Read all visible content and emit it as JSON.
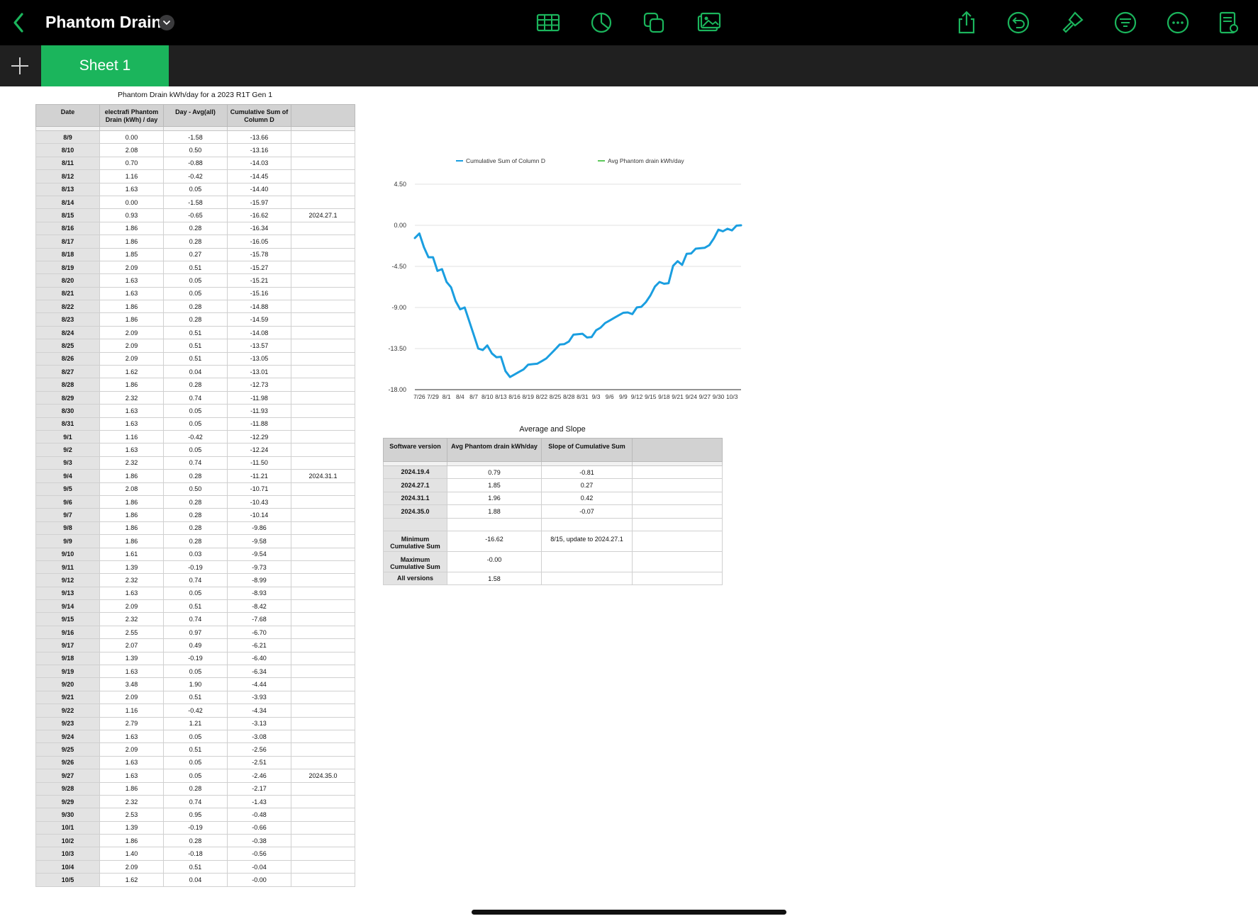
{
  "app": {
    "title": "Phantom Drain",
    "accent": "#1bb55c",
    "toolbar_icons": [
      "table-icon",
      "chart-icon",
      "shapes-icon",
      "media-icon",
      "share-icon",
      "undo-icon",
      "format-brush-icon",
      "organize-icon",
      "more-icon",
      "document-setup-icon"
    ]
  },
  "tabs": [
    {
      "label": "Sheet 1",
      "active": true
    }
  ],
  "data_table": {
    "title": "Phantom Drain kWh/day for a 2023 R1T Gen 1",
    "headers": [
      "Date",
      "electrafi Phantom Drain (kWh) / day",
      "Day - Avg(all)",
      "Cumulative Sum of Column D",
      ""
    ],
    "rows": [
      [
        "8/9",
        "0.00",
        "-1.58",
        "-13.66",
        ""
      ],
      [
        "8/10",
        "2.08",
        "0.50",
        "-13.16",
        ""
      ],
      [
        "8/11",
        "0.70",
        "-0.88",
        "-14.03",
        ""
      ],
      [
        "8/12",
        "1.16",
        "-0.42",
        "-14.45",
        ""
      ],
      [
        "8/13",
        "1.63",
        "0.05",
        "-14.40",
        ""
      ],
      [
        "8/14",
        "0.00",
        "-1.58",
        "-15.97",
        ""
      ],
      [
        "8/15",
        "0.93",
        "-0.65",
        "-16.62",
        "2024.27.1"
      ],
      [
        "8/16",
        "1.86",
        "0.28",
        "-16.34",
        ""
      ],
      [
        "8/17",
        "1.86",
        "0.28",
        "-16.05",
        ""
      ],
      [
        "8/18",
        "1.85",
        "0.27",
        "-15.78",
        ""
      ],
      [
        "8/19",
        "2.09",
        "0.51",
        "-15.27",
        ""
      ],
      [
        "8/20",
        "1.63",
        "0.05",
        "-15.21",
        ""
      ],
      [
        "8/21",
        "1.63",
        "0.05",
        "-15.16",
        ""
      ],
      [
        "8/22",
        "1.86",
        "0.28",
        "-14.88",
        ""
      ],
      [
        "8/23",
        "1.86",
        "0.28",
        "-14.59",
        ""
      ],
      [
        "8/24",
        "2.09",
        "0.51",
        "-14.08",
        ""
      ],
      [
        "8/25",
        "2.09",
        "0.51",
        "-13.57",
        ""
      ],
      [
        "8/26",
        "2.09",
        "0.51",
        "-13.05",
        ""
      ],
      [
        "8/27",
        "1.62",
        "0.04",
        "-13.01",
        ""
      ],
      [
        "8/28",
        "1.86",
        "0.28",
        "-12.73",
        ""
      ],
      [
        "8/29",
        "2.32",
        "0.74",
        "-11.98",
        ""
      ],
      [
        "8/30",
        "1.63",
        "0.05",
        "-11.93",
        ""
      ],
      [
        "8/31",
        "1.63",
        "0.05",
        "-11.88",
        ""
      ],
      [
        "9/1",
        "1.16",
        "-0.42",
        "-12.29",
        ""
      ],
      [
        "9/2",
        "1.63",
        "0.05",
        "-12.24",
        ""
      ],
      [
        "9/3",
        "2.32",
        "0.74",
        "-11.50",
        ""
      ],
      [
        "9/4",
        "1.86",
        "0.28",
        "-11.21",
        "2024.31.1"
      ],
      [
        "9/5",
        "2.08",
        "0.50",
        "-10.71",
        ""
      ],
      [
        "9/6",
        "1.86",
        "0.28",
        "-10.43",
        ""
      ],
      [
        "9/7",
        "1.86",
        "0.28",
        "-10.14",
        ""
      ],
      [
        "9/8",
        "1.86",
        "0.28",
        "-9.86",
        ""
      ],
      [
        "9/9",
        "1.86",
        "0.28",
        "-9.58",
        ""
      ],
      [
        "9/10",
        "1.61",
        "0.03",
        "-9.54",
        ""
      ],
      [
        "9/11",
        "1.39",
        "-0.19",
        "-9.73",
        ""
      ],
      [
        "9/12",
        "2.32",
        "0.74",
        "-8.99",
        ""
      ],
      [
        "9/13",
        "1.63",
        "0.05",
        "-8.93",
        ""
      ],
      [
        "9/14",
        "2.09",
        "0.51",
        "-8.42",
        ""
      ],
      [
        "9/15",
        "2.32",
        "0.74",
        "-7.68",
        ""
      ],
      [
        "9/16",
        "2.55",
        "0.97",
        "-6.70",
        ""
      ],
      [
        "9/17",
        "2.07",
        "0.49",
        "-6.21",
        ""
      ],
      [
        "9/18",
        "1.39",
        "-0.19",
        "-6.40",
        ""
      ],
      [
        "9/19",
        "1.63",
        "0.05",
        "-6.34",
        ""
      ],
      [
        "9/20",
        "3.48",
        "1.90",
        "-4.44",
        ""
      ],
      [
        "9/21",
        "2.09",
        "0.51",
        "-3.93",
        ""
      ],
      [
        "9/22",
        "1.16",
        "-0.42",
        "-4.34",
        ""
      ],
      [
        "9/23",
        "2.79",
        "1.21",
        "-3.13",
        ""
      ],
      [
        "9/24",
        "1.63",
        "0.05",
        "-3.08",
        ""
      ],
      [
        "9/25",
        "2.09",
        "0.51",
        "-2.56",
        ""
      ],
      [
        "9/26",
        "1.63",
        "0.05",
        "-2.51",
        ""
      ],
      [
        "9/27",
        "1.63",
        "0.05",
        "-2.46",
        "2024.35.0"
      ],
      [
        "9/28",
        "1.86",
        "0.28",
        "-2.17",
        ""
      ],
      [
        "9/29",
        "2.32",
        "0.74",
        "-1.43",
        ""
      ],
      [
        "9/30",
        "2.53",
        "0.95",
        "-0.48",
        ""
      ],
      [
        "10/1",
        "1.39",
        "-0.19",
        "-0.66",
        ""
      ],
      [
        "10/2",
        "1.86",
        "0.28",
        "-0.38",
        ""
      ],
      [
        "10/3",
        "1.40",
        "-0.18",
        "-0.56",
        ""
      ],
      [
        "10/4",
        "2.09",
        "0.51",
        "-0.04",
        ""
      ],
      [
        "10/5",
        "1.62",
        "0.04",
        "-0.00",
        ""
      ]
    ]
  },
  "chart_data": {
    "type": "line",
    "title": "",
    "xlabel": "",
    "ylabel": "",
    "legend_position": "top",
    "grid": true,
    "ylim": [
      -18.0,
      4.5
    ],
    "y_ticks": [
      "4.50",
      "0.00",
      "-4.50",
      "-9.00",
      "-13.50",
      "-18.00"
    ],
    "x_ticks": [
      "7/26",
      "7/29",
      "8/1",
      "8/4",
      "8/7",
      "8/10",
      "8/13",
      "8/16",
      "8/19",
      "8/22",
      "8/25",
      "8/28",
      "8/31",
      "9/3",
      "9/6",
      "9/9",
      "9/12",
      "9/15",
      "9/18",
      "9/21",
      "9/24",
      "9/27",
      "9/30",
      "10/3"
    ],
    "x_dates": [
      "7/25",
      "7/26",
      "7/27",
      "7/28",
      "7/29",
      "7/30",
      "7/31",
      "8/1",
      "8/2",
      "8/3",
      "8/4",
      "8/5",
      "8/6",
      "8/7",
      "8/8",
      "8/9",
      "8/10",
      "8/11",
      "8/12",
      "8/13",
      "8/14",
      "8/15",
      "8/16",
      "8/17",
      "8/18",
      "8/19",
      "8/20",
      "8/21",
      "8/22",
      "8/23",
      "8/24",
      "8/25",
      "8/26",
      "8/27",
      "8/28",
      "8/29",
      "8/30",
      "8/31",
      "9/1",
      "9/2",
      "9/3",
      "9/4",
      "9/5",
      "9/6",
      "9/7",
      "9/8",
      "9/9",
      "9/10",
      "9/11",
      "9/12",
      "9/13",
      "9/14",
      "9/15",
      "9/16",
      "9/17",
      "9/18",
      "9/19",
      "9/20",
      "9/21",
      "9/22",
      "9/23",
      "9/24",
      "9/25",
      "9/26",
      "9/27",
      "9/28",
      "9/29",
      "9/30",
      "10/1",
      "10/2",
      "10/3",
      "10/4",
      "10/5"
    ],
    "series": [
      {
        "name": "Cumulative Sum of Column D",
        "color": "#1a9ee0",
        "values": [
          -1.4,
          -0.9,
          -2.4,
          -3.5,
          -3.5,
          -5.0,
          -4.8,
          -6.2,
          -6.8,
          -8.3,
          -9.2,
          -9.0,
          -10.5,
          -12.0,
          -13.5,
          -13.66,
          -13.16,
          -14.03,
          -14.45,
          -14.4,
          -15.97,
          -16.62,
          -16.34,
          -16.05,
          -15.78,
          -15.27,
          -15.21,
          -15.16,
          -14.88,
          -14.59,
          -14.08,
          -13.57,
          -13.05,
          -13.01,
          -12.73,
          -11.98,
          -11.93,
          -11.88,
          -12.29,
          -12.24,
          -11.5,
          -11.21,
          -10.71,
          -10.43,
          -10.14,
          -9.86,
          -9.58,
          -9.54,
          -9.73,
          -8.99,
          -8.93,
          -8.42,
          -7.68,
          -6.7,
          -6.21,
          -6.4,
          -6.34,
          -4.44,
          -3.93,
          -4.34,
          -3.13,
          -3.08,
          -2.56,
          -2.51,
          -2.46,
          -2.17,
          -1.43,
          -0.48,
          -0.66,
          -0.38,
          -0.56,
          -0.04,
          0.0
        ]
      },
      {
        "name": "Avg Phantom drain kWh/day",
        "color": "#5cc85a",
        "values": []
      }
    ]
  },
  "summary": {
    "title": "Average and Slope",
    "headers": [
      "Software version",
      "Avg Phantom drain kWh/day",
      "Slope of Cumulative Sum",
      ""
    ],
    "rows": [
      [
        "2024.19.4",
        "0.79",
        "-0.81",
        ""
      ],
      [
        "2024.27.1",
        "1.85",
        "0.27",
        ""
      ],
      [
        "2024.31.1",
        "1.96",
        "0.42",
        ""
      ],
      [
        "2024.35.0",
        "1.88",
        "-0.07",
        ""
      ],
      [
        "",
        "",
        "",
        ""
      ]
    ],
    "min_label": "Minimum Cumulative Sum",
    "min_value": "-16.62",
    "min_note": "8/15, update to 2024.27.1",
    "max_label": "Maximum Cumulative Sum",
    "max_value": "-0.00",
    "all_label": "All versions",
    "all_value": "1.58"
  }
}
